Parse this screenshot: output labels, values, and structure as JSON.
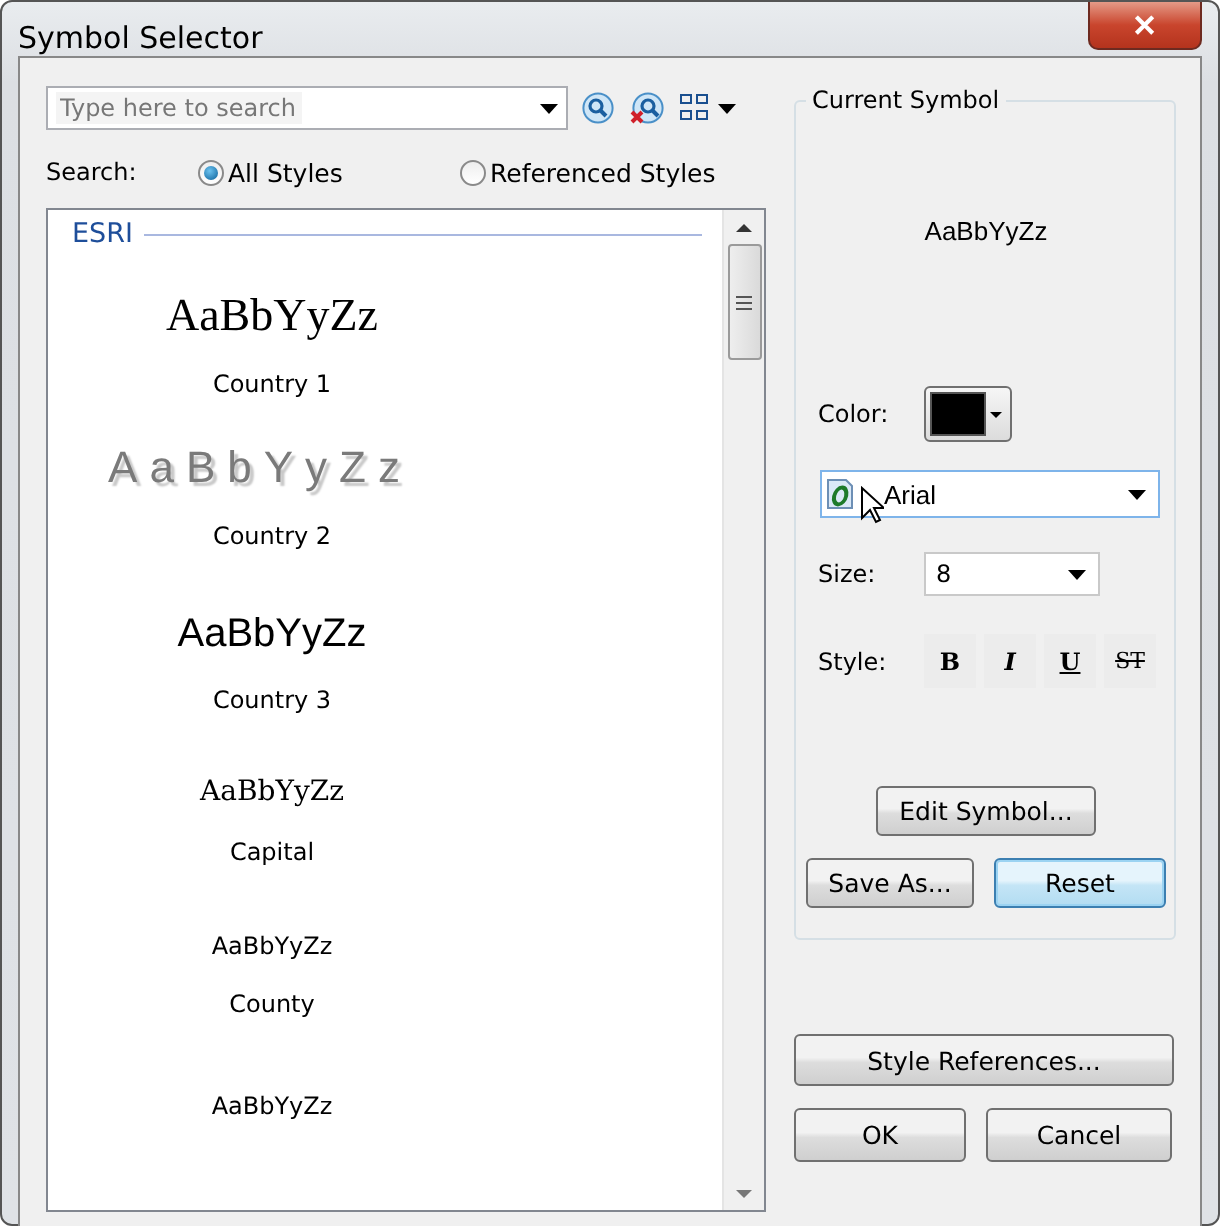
{
  "window": {
    "title": "Symbol Selector",
    "close": "✕"
  },
  "search": {
    "placeholder": "Type here to search",
    "label": "Search:"
  },
  "scope": [
    {
      "label": "All Styles",
      "selected": true
    },
    {
      "label": "Referenced Styles",
      "selected": false
    }
  ],
  "list": {
    "group": "ESRI",
    "items": [
      {
        "kind": "serif-large",
        "sample": "AaBbYyZz",
        "label": "Country 1"
      },
      {
        "kind": "shadow",
        "sample": "AaBbYyZz",
        "label": "Country 2"
      },
      {
        "kind": "sans-large",
        "sample": "AaBbYyZz",
        "label": "Country 3"
      },
      {
        "kind": "serif-medium",
        "sample": "AaBbYyZz",
        "label": "Capital"
      },
      {
        "kind": "sans-small",
        "sample": "AaBbYyZz",
        "label": "County"
      },
      {
        "kind": "sans-small",
        "sample": "AaBbYyZz"
      }
    ]
  },
  "current": {
    "title": "Current Symbol",
    "preview": "AaBbYyZz",
    "color_label": "Color:",
    "color": "#000000",
    "font": "Arial",
    "size_label": "Size:",
    "size": "8",
    "style_label": "Style:",
    "styles": [
      {
        "kind": "bold",
        "label": "B"
      },
      {
        "kind": "italic",
        "label": "I"
      },
      {
        "kind": "underline",
        "label": "U"
      },
      {
        "kind": "strike",
        "label": "ST"
      }
    ],
    "edit": "Edit Symbol...",
    "save": "Save As...",
    "reset": "Reset"
  },
  "buttons": {
    "references": "Style References...",
    "ok": "OK",
    "cancel": "Cancel"
  }
}
